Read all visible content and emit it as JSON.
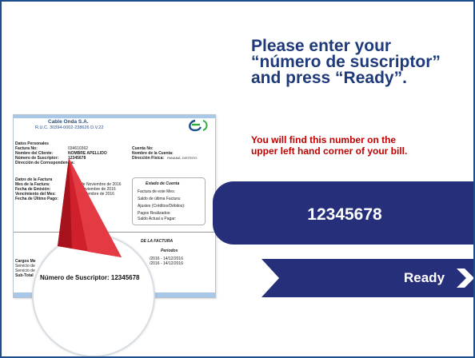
{
  "instruction": {
    "line1": "Please enter your",
    "line2": "“número de suscriptor”",
    "line3": "and press “Ready”."
  },
  "hint": {
    "line1": "You will find this number on the",
    "line2": "upper left hand corner of your bill."
  },
  "number_field": {
    "value": "12345678"
  },
  "ready_button": {
    "label": "Ready"
  },
  "bill": {
    "company": "Cable Onda S.A.",
    "ruc": "R.U.C. 30394-0002-238626 D.V.22",
    "left_labels": [
      "Datos Personales",
      "Factura No:",
      "Nombre del Cliente:",
      "Número de Suscriptor:",
      "Dirección de Correspondencia:"
    ],
    "left_values": [
      "034610362",
      "NOMBRE APELLIDO",
      "12345678"
    ],
    "right_labels": [
      "Cuenta No:",
      "Nombre de la Cuenta:",
      "Dirección Física:"
    ],
    "right_value_address": "PANAMÁ, DISTRITO",
    "dates_title": "Datos de la Factura",
    "date_labels": [
      "Mes de la Factura:",
      "Fecha de Emisión:",
      "Vencimiento del Mes:",
      "Fecha de Último Pago:"
    ],
    "date_values": [
      "de Noviembre de 2016",
      "Noviembre de 2016",
      "Diciembre de 2016"
    ],
    "estado_title": "Estado de Cuenta",
    "estado_items": [
      "Factura de este Mes:",
      "Saldo de última Factura:",
      "Ajustes (Créditos/Débitos):",
      "Pagos Realizados:",
      "Saldo Actual a Pagar:"
    ],
    "detail_title": "DE LA FACTURA",
    "periods_title": "Periodos",
    "period_values": [
      "/2016 - 14/12/2016",
      "/2016 - 14/12/2016"
    ],
    "charges_labels": [
      "Cargos Me",
      "Servicio de",
      "Servicio de",
      "Sub-Total"
    ]
  },
  "magnifier": {
    "text": "Número de Suscriptor: 12345678"
  },
  "colors": {
    "navy": "#26307a",
    "title_blue": "#1f3a7a",
    "hint_red": "#c00000",
    "pointer_red": "#d0202c"
  }
}
